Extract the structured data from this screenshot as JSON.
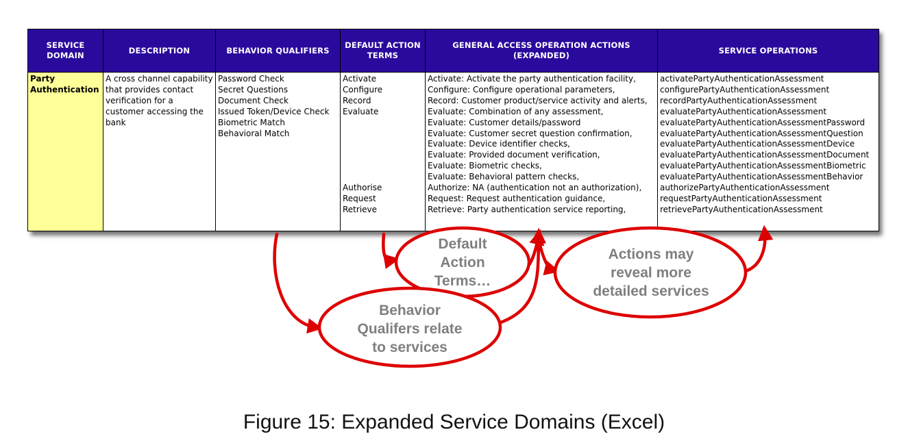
{
  "table": {
    "headers": [
      "SERVICE DOMAIN",
      "DESCRIPTION",
      "BEHAVIOR QUALIFIERS",
      "DEFAULT ACTION TERMS",
      "GENERAL ACCESS OPERATION ACTIONS (EXPANDED)",
      "SERVICE OPERATIONS"
    ],
    "service_domain": "Party Authentication",
    "description": "A cross channel capability that provides contact verification for a customer accessing the bank",
    "behavior_qualifiers": [
      "Password Check",
      "Secret Questions",
      "Document Check",
      "Issued Token/Device Check",
      "Biometric Match",
      "Behavioral Match"
    ],
    "default_action_terms_top": [
      "Activate",
      "Configure",
      "Record",
      "Evaluate"
    ],
    "default_action_terms_bottom": [
      "Authorise",
      "Request",
      "Retrieve"
    ],
    "general_access_actions": [
      "Activate: Activate the party authentication facility,",
      "Configure: Configure operational parameters,",
      "Record: Customer product/service activity and alerts,",
      "Evaluate: Combination of any assessment,",
      "Evaluate: Customer details/password",
      "Evaluate: Customer secret question confirmation,",
      "Evaluate: Device identifier checks,",
      "Evaluate: Provided document verification,",
      "Evaluate: Biometric checks,",
      "Evaluate: Behavioral pattern checks,",
      "Authorize: NA (authentication not an authorization),",
      "Request: Request authentication guidance,",
      "Retrieve: Party authentication service reporting,"
    ],
    "service_operations": [
      "activatePartyAuthenticationAssessment",
      "configurePartyAuthenticationAssessment",
      "recordPartyAuthenticationAssessment",
      "evaluatePartyAuthenticationAssessment",
      "evaluatePartyAuthenticationAssessmentPassword",
      "evaluatePartyAuthenticationAssessmentQuestion",
      "evaluatePartyAuthenticationAssessmentDevice",
      "evaluatePartyAuthenticationAssessmentDocument",
      "evaluatePartyAuthenticationAssessmentBiometric",
      "evaluatePartyAuthenticationAssessmentBehavior",
      "authorizePartyAuthenticationAssessment",
      "requestPartyAuthenticationAssessment",
      "retrievePartyAuthenticationAssessment"
    ]
  },
  "callouts": {
    "default_action_terms": [
      "Default",
      "Action",
      "Terms…"
    ],
    "behavior_qualifiers": [
      "Behavior",
      "Qualifers relate",
      "to services"
    ],
    "actions_reveal": [
      "Actions may",
      "reveal more",
      "detailed services"
    ]
  },
  "caption": "Figure 15: Expanded Service Domains (Excel)",
  "colors": {
    "header_bg": "#2a0a9c",
    "domain_cell_bg": "#ffff99",
    "callout_red": "#dd0000",
    "callout_text": "#7f7f7f"
  }
}
